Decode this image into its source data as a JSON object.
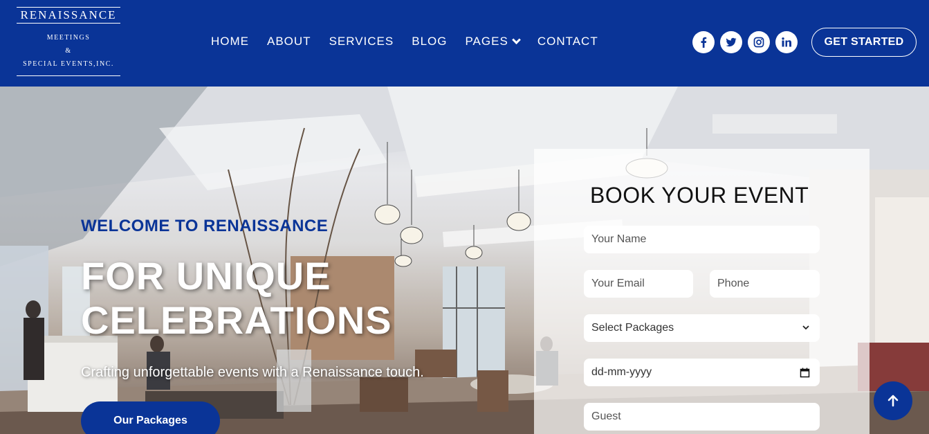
{
  "brand": {
    "name": "RENAISSANCE",
    "line1": "MEETINGS",
    "line2": "&",
    "line3": "SPECIAL EVENTS,INC."
  },
  "nav": {
    "items": [
      {
        "label": "HOME"
      },
      {
        "label": "ABOUT"
      },
      {
        "label": "SERVICES"
      },
      {
        "label": "BLOG"
      },
      {
        "label": "PAGES",
        "has_dropdown": true
      },
      {
        "label": "CONTACT"
      }
    ]
  },
  "social": {
    "icons": [
      "facebook-icon",
      "twitter-icon",
      "instagram-icon",
      "linkedin-icon"
    ]
  },
  "header": {
    "cta_label": "GET STARTED"
  },
  "hero": {
    "welcome": "WELCOME TO RENAISSANCE",
    "headline_line1": "FOR UNIQUE",
    "headline_line2": "CELEBRATIONS",
    "tagline": "Crafting unforgettable events with a Renaissance touch.",
    "button_label": "Our Packages"
  },
  "booking": {
    "title": "BOOK YOUR EVENT",
    "name_placeholder": "Your Name",
    "email_placeholder": "Your Email",
    "phone_placeholder": "Phone",
    "package_selected": "Select Packages",
    "date_placeholder": "dd-mm-yyyy",
    "guest_placeholder": "Guest"
  },
  "colors": {
    "brand_blue": "#0a3497",
    "white": "#ffffff"
  }
}
